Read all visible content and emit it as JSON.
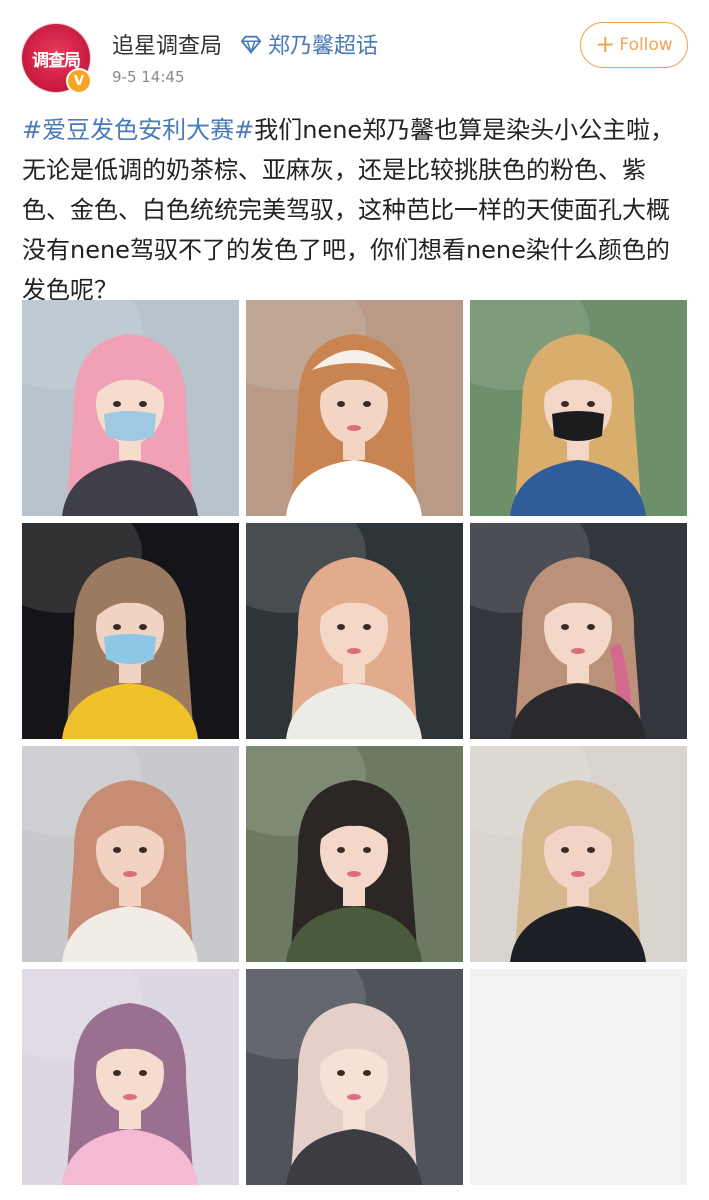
{
  "post": {
    "author": "追星调查局",
    "avatar_text": "调查局",
    "verified_badge": "V",
    "super_topic": "郑乃馨超话",
    "timestamp": "9-5 14:45",
    "follow_label": "Follow",
    "hashtag": "#爱豆发色安利大赛#",
    "body_text": "我们nene郑乃馨也算是染头小公主啦，无论是低调的奶茶棕、亚麻灰，还是比较挑肤色的粉色、紫色、金色、白色统统完美驾驭，这种芭比一样的天使面孔大概没有nene驾驭不了的发色了吧，你们想看nene染什么颜色的发色呢？"
  },
  "colors": {
    "link_blue": "#4a7ab8",
    "follow_orange": "#f0a553",
    "avatar_red": "#c8193e"
  },
  "icons": {
    "super_topic": "diamond-icon",
    "follow": "plus-icon"
  },
  "photos": [
    {
      "name": "photo-pink-hair-street",
      "bg": "#b8c3cc",
      "hair": "#f0a1b6",
      "skin": "#f6dccd",
      "cloth": "#3e3f48",
      "mask": "#9fc8e3"
    },
    {
      "name": "photo-ginger-hair-closeup",
      "bg": "#b89a86",
      "hair": "#c98452",
      "skin": "#f3d5c4",
      "cloth": "#ffffff",
      "hat": "#f6f0ea"
    },
    {
      "name": "photo-blonde-black-mask",
      "bg": "#6d8f6a",
      "hair": "#d9ae6c",
      "skin": "#f2d6c6",
      "cloth": "#2f5c9a",
      "mask": "#1c1c1f"
    },
    {
      "name": "photo-brown-hair-blue-mask",
      "bg": "#151519",
      "hair": "#9b7a60",
      "skin": "#f0d3c3",
      "cloth": "#f0c229",
      "mask": "#8ec7e5"
    },
    {
      "name": "photo-peach-hair-smile",
      "bg": "#2e3538",
      "hair": "#e2ab8e",
      "skin": "#f5d7c8",
      "cloth": "#ecebe6"
    },
    {
      "name": "photo-pink-streak-hair",
      "bg": "#33363d",
      "hair": "#bb9279",
      "skin": "#f3d7c8",
      "cloth": "#2a2a2e",
      "streak": "#d4698d"
    },
    {
      "name": "photo-rose-gold-curls",
      "bg": "#c8c9cd",
      "hair": "#c78c74",
      "skin": "#f2d2c0",
      "cloth": "#f1ece6"
    },
    {
      "name": "photo-green-outfit-umbrella",
      "bg": "#6b7a61",
      "hair": "#2c2624",
      "skin": "#f3d8ca",
      "cloth": "#4a5a3c"
    },
    {
      "name": "photo-braids-window",
      "bg": "#d9d4cd",
      "hair": "#d6b68d",
      "skin": "#f1d4c5",
      "cloth": "#1d1f26"
    },
    {
      "name": "photo-lavender-hair",
      "bg": "#ddd7e3",
      "hair": "#9a6f90",
      "skin": "#f5dccf",
      "cloth": "#f4b9d3"
    },
    {
      "name": "photo-platinum-hair",
      "bg": "#50535a",
      "hair": "#e5cfc8",
      "skin": "#f7e0d5",
      "cloth": "#3c3d42"
    }
  ]
}
